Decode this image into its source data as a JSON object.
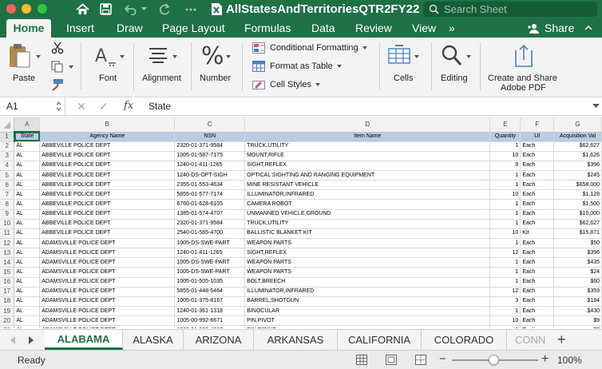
{
  "titlebar": {
    "doc_title": "AllStatesAndTerritoriesQTR2FY22",
    "search_placeholder": "Search Sheet"
  },
  "ribbon_tabs": [
    "Home",
    "Insert",
    "Draw",
    "Page Layout",
    "Formulas",
    "Data",
    "Review",
    "View",
    "»"
  ],
  "share_label": "Share",
  "ribbon": {
    "paste": "Paste",
    "font": "Font",
    "alignment": "Alignment",
    "number": "Number",
    "conditional_formatting": "Conditional Formatting",
    "format_as_table": "Format as Table",
    "cell_styles": "Cell Styles",
    "cells": "Cells",
    "editing": "Editing",
    "create_share_line1": "Create and Share",
    "create_share_line2": "Adobe PDF"
  },
  "formula_bar": {
    "name_box": "A1",
    "fx": "fx",
    "value": "State"
  },
  "grid": {
    "columns": [
      "A",
      "B",
      "C",
      "D",
      "E",
      "F",
      "G"
    ],
    "header": [
      "State",
      "Agency Name",
      "NSN",
      "Item Name",
      "Quantity",
      "UI",
      "Acquisition Val"
    ],
    "rows": [
      [
        "AL",
        "ABBEVILLE POLICE DEPT",
        "2320-01-371-9584",
        "TRUCK,UTILITY",
        "1",
        "Each",
        "$62,627"
      ],
      [
        "AL",
        "ABBEVILLE POLICE DEPT",
        "1005-01-587-7175",
        "MOUNT,RIFLE",
        "10",
        "Each",
        "$1,626"
      ],
      [
        "AL",
        "ABBEVILLE POLICE DEPT",
        "1240-01-411-1265",
        "SIGHT,REFLEX",
        "9",
        "Each",
        "$396"
      ],
      [
        "AL",
        "ABBEVILLE POLICE DEPT",
        "1240-DS-OPT-SIGH",
        "OPTICAL SIGHTING AND RANGING EQUIPMENT",
        "1",
        "Each",
        "$245"
      ],
      [
        "AL",
        "ABBEVILLE POLICE DEPT",
        "2355-01-553-4634",
        "MINE RESISTANT VEHICLE",
        "1",
        "Each",
        "$658,000"
      ],
      [
        "AL",
        "ABBEVILLE POLICE DEPT",
        "5855-01-577-7174",
        "ILLUMINATOR,INFRARED",
        "10",
        "Each",
        "$1,128"
      ],
      [
        "AL",
        "ABBEVILLE POLICE DEPT",
        "6760-01-628-6105",
        "CAMERA ROBOT",
        "1",
        "Each",
        "$1,500"
      ],
      [
        "AL",
        "ABBEVILLE POLICE DEPT",
        "1385-01-574-4707",
        "UNMANNED VEHICLE,GROUND",
        "1",
        "Each",
        "$10,000"
      ],
      [
        "AL",
        "ABBEVILLE POLICE DEPT",
        "2320-01-371-9584",
        "TRUCK,UTILITY",
        "1",
        "Each",
        "$62,627"
      ],
      [
        "AL",
        "ABBEVILLE POLICE DEPT",
        "2540-01-565-4700",
        "BALLISTIC BLANKET KIT",
        "10",
        "Kit",
        "$15,871"
      ],
      [
        "AL",
        "ADAMSVILLE POLICE DEPT",
        "1005-DS-SWE-PART",
        "WEAPON PARTS",
        "1",
        "Each",
        "$50"
      ],
      [
        "AL",
        "ADAMSVILLE POLICE DEPT",
        "1240-01-411-1265",
        "SIGHT,REFLEX",
        "12",
        "Each",
        "$396"
      ],
      [
        "AL",
        "ADAMSVILLE POLICE DEPT",
        "1005-DS-SWE-PART",
        "WEAPON PARTS",
        "1",
        "Each",
        "$435"
      ],
      [
        "AL",
        "ADAMSVILLE POLICE DEPT",
        "1005-DS-SWE-PART",
        "WEAPON PARTS",
        "1",
        "Each",
        "$24"
      ],
      [
        "AL",
        "ADAMSVILLE POLICE DEPT",
        "1005-01-505-1035",
        "BOLT,BREECH",
        "1",
        "Each",
        "$60"
      ],
      [
        "AL",
        "ADAMSVILLE POLICE DEPT",
        "5855-01-448-5464",
        "ILLUMINATOR,INFRARED",
        "12",
        "Each",
        "$359"
      ],
      [
        "AL",
        "ADAMSVILLE POLICE DEPT",
        "1005-01-375-8167",
        "BARREL,SHOTGUN",
        "3",
        "Each",
        "$184"
      ],
      [
        "AL",
        "ADAMSVILLE POLICE DEPT",
        "1240-01-361-1318",
        "BINOCULAR",
        "1",
        "Each",
        "$430"
      ],
      [
        "AL",
        "ADAMSVILLE POLICE DEPT",
        "1005-00-992-6671",
        "PIN,PIVOT",
        "10",
        "Each",
        "$9"
      ],
      [
        "AL",
        "ADAMSVILLE POLICE DEPT",
        "1005-01-563-4027",
        "PIN,FIRING",
        "1",
        "Each",
        "$7"
      ]
    ]
  },
  "sheet_tabs": [
    "ALABAMA",
    "ALASKA",
    "ARIZONA",
    "ARKANSAS",
    "CALIFORNIA",
    "COLORADO",
    "CONN"
  ],
  "status": {
    "text": "Ready",
    "zoom": "100%"
  },
  "colors": {
    "accent": "#1e7145",
    "header_fill": "#b8cce4"
  }
}
